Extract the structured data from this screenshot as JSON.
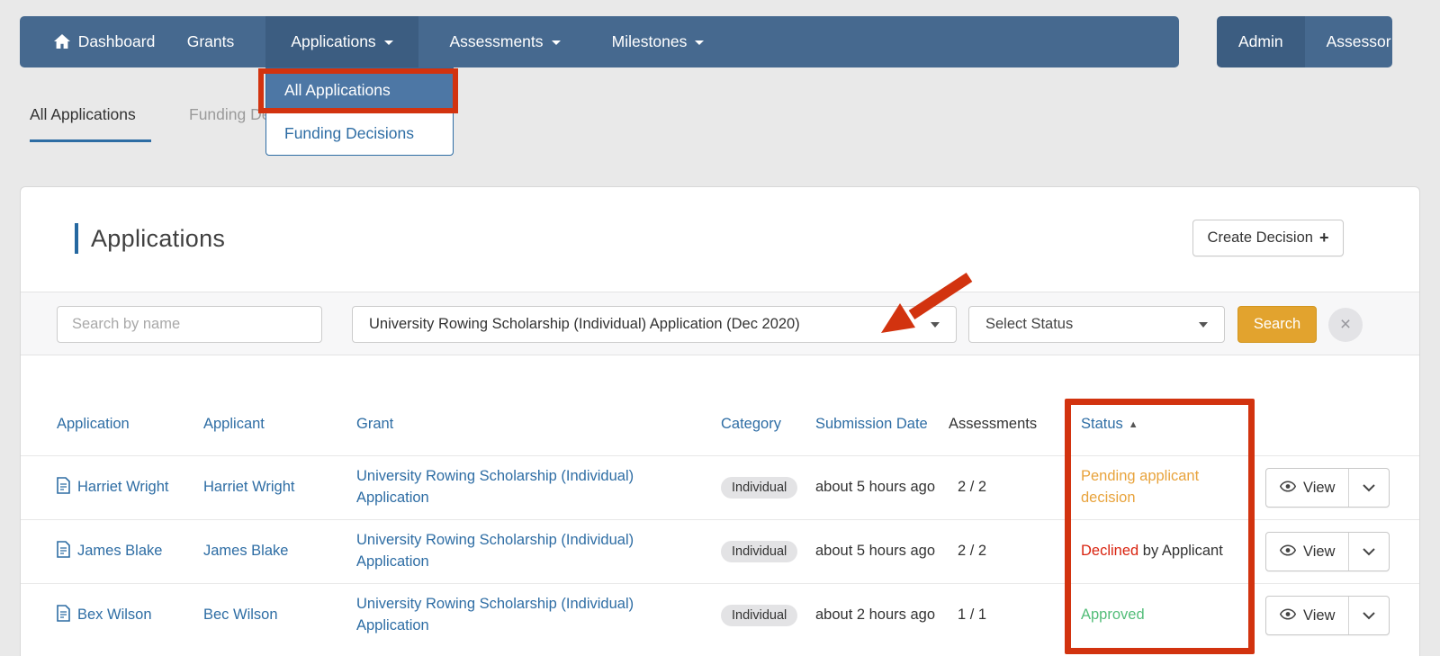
{
  "nav": {
    "dashboard": "Dashboard",
    "grants": "Grants",
    "applications": "Applications",
    "assessments": "Assessments",
    "milestones": "Milestones",
    "admin": "Admin",
    "assessor": "Assessor"
  },
  "applications_menu": {
    "all_applications": "All Applications",
    "funding_decisions": "Funding Decisions"
  },
  "tabs": {
    "all_applications": "All Applications",
    "funding_decisions": "Funding Decisions"
  },
  "page": {
    "title": "Applications",
    "create_decision_label": "Create Decision",
    "create_decision_icon": "+"
  },
  "filters": {
    "search_placeholder": "Search by name",
    "grant_filter_value": "University Rowing Scholarship (Individual) Application (Dec 2020)",
    "status_filter_placeholder": "Select Status",
    "search_button_label": "Search",
    "clear_button_icon": "×"
  },
  "table": {
    "headers": {
      "application": "Application",
      "applicant": "Applicant",
      "grant": "Grant",
      "category": "Category",
      "submission_date": "Submission Date",
      "assessments": "Assessments",
      "status": "Status",
      "status_sort_indicator": "▲"
    },
    "view_label": "View",
    "rows": [
      {
        "application": "Harriet Wright",
        "applicant": "Harriet Wright",
        "grant": "University Rowing Scholarship (Individual) Application",
        "category": "Individual",
        "submitted": "about 5 hours ago",
        "assessments": "2 / 2",
        "status_primary": "Pending applicant decision",
        "status_suffix": "",
        "status_class": "st-orange"
      },
      {
        "application": "James Blake",
        "applicant": "James Blake",
        "grant": "University Rowing Scholarship (Individual) Application",
        "category": "Individual",
        "submitted": "about 5 hours ago",
        "assessments": "2 / 2",
        "status_primary": "Declined",
        "status_suffix": " by Applicant",
        "status_class": "st-red"
      },
      {
        "application": "Bex Wilson",
        "applicant": "Bec Wilson",
        "grant": "University Rowing Scholarship (Individual) Application",
        "category": "Individual",
        "submitted": "about 2 hours ago",
        "assessments": "1 / 1",
        "status_primary": "Approved",
        "status_suffix": "",
        "status_class": "st-green"
      }
    ]
  },
  "colors": {
    "nav_blue": "#46698f",
    "nav_blue_dark": "#3c5d81",
    "menu_highlight_blue": "#4d77a5",
    "link_blue": "#2e6da4",
    "status_orange": "#e8a33c",
    "status_red": "#d9230f",
    "status_green": "#53bd79",
    "search_button_orange": "#e2a32e",
    "annotation_red": "#d2330f"
  }
}
